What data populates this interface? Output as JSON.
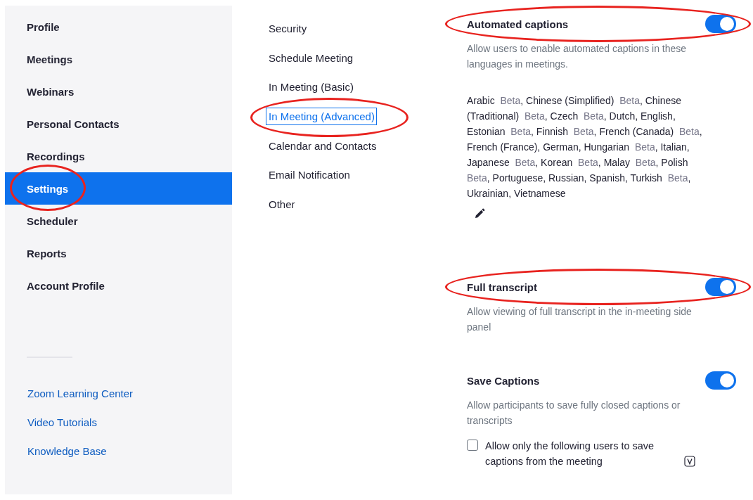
{
  "sidebar": {
    "items": [
      {
        "label": "Profile",
        "selected": false,
        "highlighted": false
      },
      {
        "label": "Meetings",
        "selected": false,
        "highlighted": false
      },
      {
        "label": "Webinars",
        "selected": false,
        "highlighted": false
      },
      {
        "label": "Personal Contacts",
        "selected": false,
        "highlighted": false
      },
      {
        "label": "Recordings",
        "selected": false,
        "highlighted": false
      },
      {
        "label": "Settings",
        "selected": true,
        "highlighted": true
      },
      {
        "label": "Scheduler",
        "selected": false,
        "highlighted": false
      },
      {
        "label": "Reports",
        "selected": false,
        "highlighted": false
      },
      {
        "label": "Account Profile",
        "selected": false,
        "highlighted": false
      }
    ],
    "links": [
      "Zoom Learning Center",
      "Video Tutorials",
      "Knowledge Base"
    ]
  },
  "subnav": {
    "items": [
      {
        "label": "Security",
        "selected": false,
        "highlighted": false
      },
      {
        "label": "Schedule Meeting",
        "selected": false,
        "highlighted": false
      },
      {
        "label": "In Meeting (Basic)",
        "selected": false,
        "highlighted": false
      },
      {
        "label": "In Meeting (Advanced)",
        "selected": true,
        "highlighted": true
      },
      {
        "label": "Calendar and Contacts",
        "selected": false,
        "highlighted": false
      },
      {
        "label": "Email Notification",
        "selected": false,
        "highlighted": false
      },
      {
        "label": "Other",
        "selected": false,
        "highlighted": false
      }
    ]
  },
  "settings": [
    {
      "title": "Automated captions",
      "on": true,
      "highlighted": true,
      "description": "Allow users to enable automated captions in these languages in meetings.",
      "languages": [
        {
          "name": "Arabic",
          "tag": "Beta",
          "sep": ","
        },
        {
          "name": "Chinese (Simplified)",
          "tag": "Beta",
          "sep": ","
        },
        {
          "name": "Chinese (Traditional)",
          "tag": "Beta",
          "sep": ","
        },
        {
          "name": "Czech",
          "tag": "Beta",
          "sep": ","
        },
        {
          "name": "Dutch",
          "sep": ","
        },
        {
          "name": "English",
          "sep": ","
        },
        {
          "name": "Estonian",
          "tag": "Beta",
          "sep": ","
        },
        {
          "name": "Finnish",
          "tag": "Beta",
          "sep": ","
        },
        {
          "name": "French (Canada)",
          "tag": "Beta",
          "sep": ","
        },
        {
          "name": "French (France)",
          "sep": ","
        },
        {
          "name": "German",
          "sep": ","
        },
        {
          "name": "Hungarian",
          "tag": "Beta",
          "sep": ","
        },
        {
          "name": "Italian",
          "sep": ","
        },
        {
          "name": "Japanese",
          "tag": "Beta",
          "sep": ","
        },
        {
          "name": "Korean",
          "tag": "Beta",
          "sep": ","
        },
        {
          "name": "Malay",
          "tag": "Beta",
          "sep": ","
        },
        {
          "name": "Polish",
          "tag": "Beta",
          "sep": ","
        },
        {
          "name": "Portuguese",
          "sep": ","
        },
        {
          "name": "Russian",
          "sep": ","
        },
        {
          "name": "Spanish",
          "sep": ","
        },
        {
          "name": "Turkish",
          "tag": "Beta",
          "sep": ","
        },
        {
          "name": "Ukrainian",
          "sep": ","
        },
        {
          "name": "Vietnamese"
        }
      ]
    },
    {
      "title": "Full transcript",
      "on": true,
      "highlighted": true,
      "description": "Allow viewing of full transcript in the in-meeting side panel"
    },
    {
      "title": "Save Captions",
      "on": true,
      "highlighted": false,
      "description": "Allow participants to save fully closed captions or transcripts",
      "options": [
        {
          "label": "Allow only the following users to save captions from the meeting",
          "checked": false
        }
      ]
    }
  ]
}
